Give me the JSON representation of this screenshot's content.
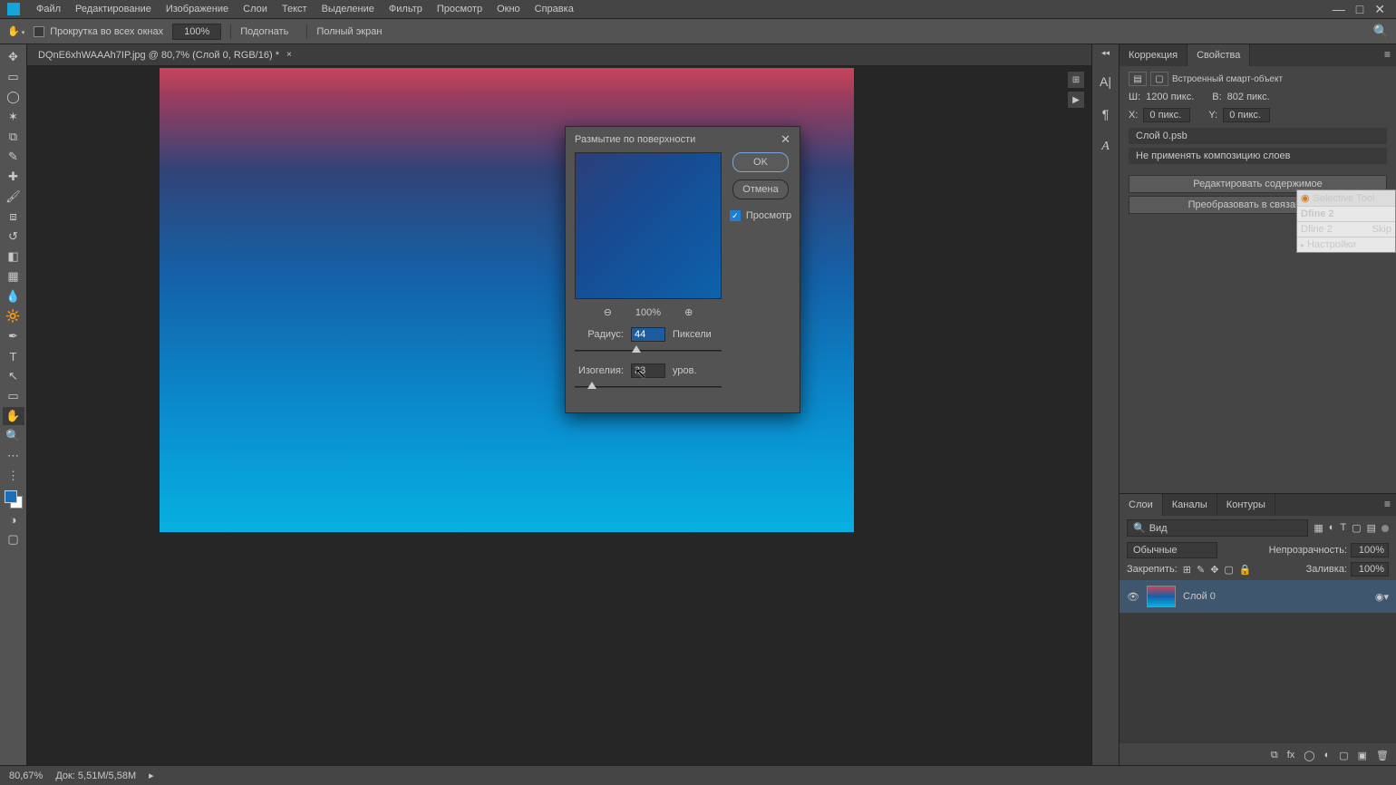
{
  "menu": [
    "Файл",
    "Редактирование",
    "Изображение",
    "Слои",
    "Текст",
    "Выделение",
    "Фильтр",
    "Просмотр",
    "Окно",
    "Справка"
  ],
  "options": {
    "scroll_all": "Прокрутка во всех окнах",
    "zoom": "100%",
    "fit": "Подогнать",
    "fullscreen": "Полный экран"
  },
  "doc": {
    "title": "DQnE6xhWAAAh7IP.jpg @ 80,7% (Слой 0, RGB/16) *"
  },
  "dialog": {
    "title": "Размытие по поверхности",
    "ok": "OK",
    "cancel": "Отмена",
    "preview_label": "Просмотр",
    "zoom": "100%",
    "radius_label": "Радиус:",
    "radius_value": "44",
    "radius_unit": "Пиксели",
    "threshold_label": "Изогелия:",
    "threshold_value": "33",
    "threshold_unit": "уров."
  },
  "panels": {
    "correction_tab": "Коррекция",
    "properties_tab": "Свойства",
    "smart_object": "Встроенный смарт-объект",
    "W": "Ш:",
    "W_val": "1200 пикс.",
    "H": "В:",
    "H_val": "802 пикс.",
    "X": "X:",
    "X_val": "0 пикс.",
    "Y": "Y:",
    "Y_val": "0 пикс.",
    "psb": "Слой 0.psb",
    "comp_none": "Не применять композицию слоев",
    "edit_contents": "Редактировать содержимое",
    "convert_linked": "Преобразовать в связанные..."
  },
  "plugin": {
    "selective": "Selective Tool",
    "dfine": "Dfine 2",
    "item3": "Dfine 2",
    "skip": "Skip",
    "settings": "Настройки"
  },
  "layers": {
    "tab_layers": "Слои",
    "tab_channels": "Каналы",
    "tab_paths": "Контуры",
    "kind": "Вид",
    "mode": "Обычные",
    "opacity_label": "Непрозрачность:",
    "opacity": "100%",
    "lock_label": "Закрепить:",
    "fill_label": "Заливка:",
    "fill": "100%",
    "layer0": "Слой 0"
  },
  "status": {
    "zoom": "80,67%",
    "doc": "Док: 5,51M/5,58M"
  }
}
